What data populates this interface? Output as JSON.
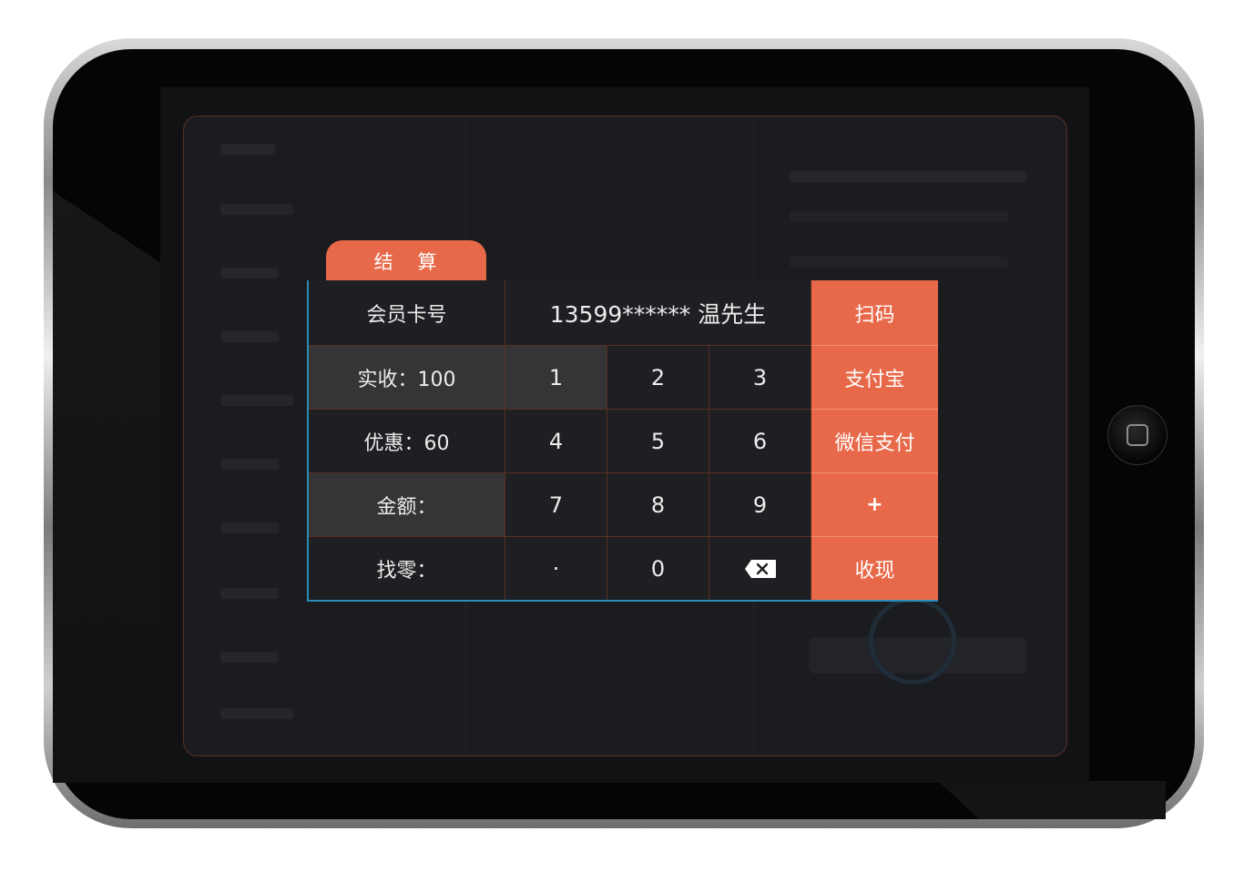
{
  "dialog": {
    "title": "结 算",
    "member_label": "会员卡号",
    "member_value": "13599****** 温先生",
    "received": {
      "label": "实收",
      "value": "100",
      "text": "实收：100"
    },
    "discount": {
      "label": "优惠",
      "value": "60",
      "text": "优惠：60"
    },
    "amount": {
      "label": "金额",
      "text": "金额："
    },
    "change": {
      "label": "找零",
      "text": "找零："
    },
    "keypad": {
      "k1": "1",
      "k2": "2",
      "k3": "3",
      "k4": "4",
      "k5": "5",
      "k6": "6",
      "k7": "7",
      "k8": "8",
      "k9": "9",
      "dot": "·",
      "k0": "0",
      "backspace_icon": "backspace-icon"
    },
    "actions": {
      "scan": "扫码",
      "alipay": "支付宝",
      "wechat": "微信支付",
      "plus": "+",
      "cash": "收现"
    }
  },
  "colors": {
    "accent": "#e8694a",
    "dialog_bg": "#1e1f22",
    "highlight_cell": "#353538",
    "frame_line": "#2a8cb6",
    "grid_line": "#5b2f25"
  },
  "device": {
    "home_button_icon": "home-button-icon"
  }
}
